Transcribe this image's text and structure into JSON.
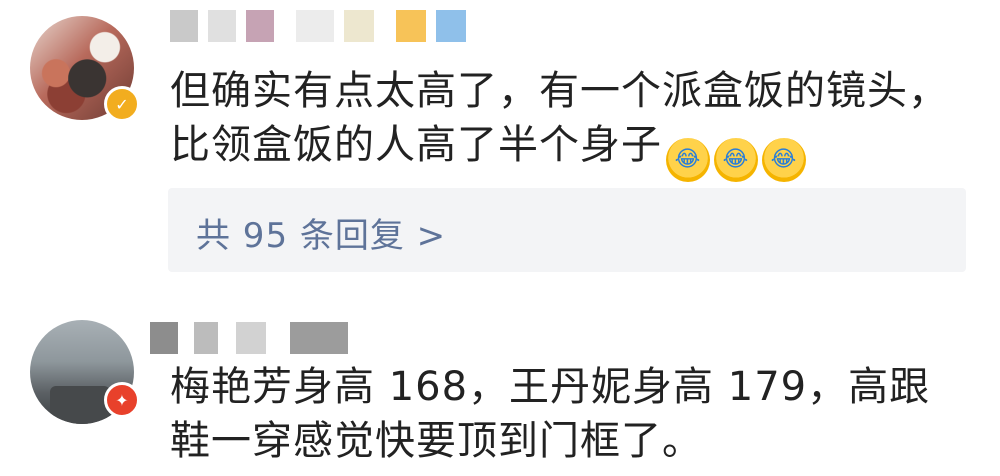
{
  "comments": [
    {
      "text": "但确实有点太高了，有一个派盒饭的镜头，比领盒饭的人高了半个身子",
      "emojis": [
        "😂",
        "😂",
        "😂"
      ],
      "badge": "✓",
      "badge_color": "#f2ad1f",
      "reply_summary": "共 95 条回复 >"
    },
    {
      "text": "梅艳芳身高 168，王丹妮身高 179，高跟鞋一穿感觉快要顶到门框了。",
      "badge": "✦",
      "badge_color": "#e8412b"
    }
  ]
}
